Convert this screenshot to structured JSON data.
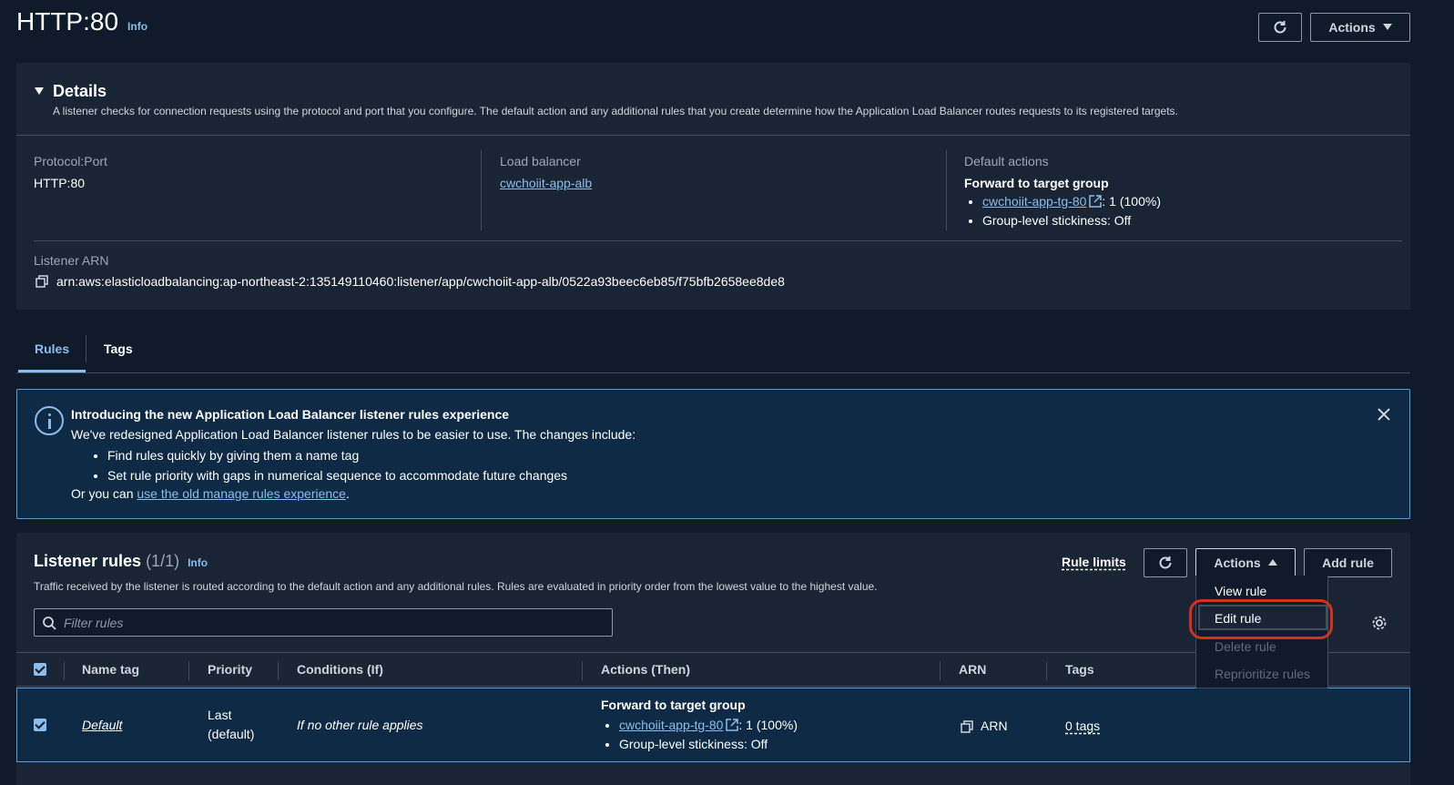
{
  "header": {
    "title": "HTTP:80",
    "info": "Info",
    "actions_label": "Actions"
  },
  "details": {
    "title": "Details",
    "description": "A listener checks for connection requests using the protocol and port that you configure. The default action and any additional rules that you create determine how the Application Load Balancer routes requests to its registered targets.",
    "protocol_label": "Protocol:Port",
    "protocol_value": "HTTP:80",
    "lb_label": "Load balancer",
    "lb_value": "cwchoiit-app-alb",
    "default_label": "Default actions",
    "default_heading": "Forward to target group",
    "default_tg": "cwchoiit-app-tg-80",
    "default_tg_weight": ": 1 (100%)",
    "default_stickiness": "Group-level stickiness: Off",
    "arn_label": "Listener ARN",
    "arn_value": "arn:aws:elasticloadbalancing:ap-northeast-2:135149110460:listener/app/cwchoiit-app-alb/0522a93beec6eb85/f75bfb2658ee8de8"
  },
  "tabs": [
    {
      "label": "Rules",
      "active": true
    },
    {
      "label": "Tags",
      "active": false
    }
  ],
  "flash": {
    "title": "Introducing the new Application Load Balancer listener rules experience",
    "line1": "We've redesigned Application Load Balancer listener rules to be easier to use. The changes include:",
    "bullets": [
      "Find rules quickly by giving them a name tag",
      "Set rule priority with gaps in numerical sequence to accommodate future changes"
    ],
    "line_prefix": "Or you can ",
    "link": "use the old manage rules experience",
    "line_suffix": "."
  },
  "rules": {
    "title": "Listener rules",
    "count": "(1/1)",
    "info": "Info",
    "description": "Traffic received by the listener is routed according to the default action and any additional rules. Rules are evaluated in priority order from the lowest value to the highest value.",
    "rule_limits": "Rule limits",
    "actions_label": "Actions",
    "add_rule": "Add rule",
    "filter_placeholder": "Filter rules",
    "columns": [
      "Name tag",
      "Priority",
      "Conditions (If)",
      "Actions (Then)",
      "ARN",
      "Tags"
    ],
    "row": {
      "name": "Default",
      "priority_1": "Last",
      "priority_2": "(default)",
      "condition": "If no other rule applies",
      "action_heading": "Forward to target group",
      "action_tg": "cwchoiit-app-tg-80",
      "action_weight": ": 1 (100%)",
      "action_stickiness": "Group-level stickiness: Off",
      "arn": "ARN",
      "tags": "0 tags"
    },
    "menu": [
      {
        "label": "View rule",
        "enabled": true
      },
      {
        "label": "Edit rule",
        "enabled": true,
        "highlighted": true
      },
      {
        "label": "Delete rule",
        "enabled": false
      },
      {
        "label": "Reprioritize rules",
        "enabled": false
      }
    ]
  },
  "colors": {
    "background": "#0f1b2a",
    "panel": "#192534",
    "link": "#89bdee",
    "highlight_circle": "#d5301a"
  }
}
